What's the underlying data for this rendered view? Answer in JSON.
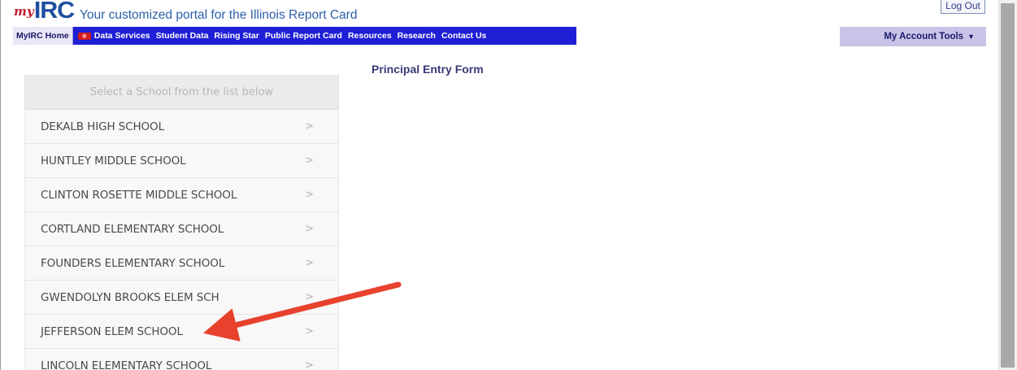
{
  "header": {
    "logo_prefix": "my",
    "logo_main": "IRC",
    "tagline": "Your customized portal for the Illinois Report Card",
    "logout_label": "Log Out"
  },
  "nav": {
    "home_label": "MyIRC Home",
    "items": [
      "Data Services",
      "Student Data",
      "Rising Star",
      "Public Report Card",
      "Resources",
      "Research",
      "Contact Us"
    ],
    "account_tools_label": "My Account Tools"
  },
  "main": {
    "form_title": "Principal Entry Form"
  },
  "school_list": {
    "header": "Select a School from the list below",
    "schools": [
      "DEKALB HIGH SCHOOL",
      "HUNTLEY MIDDLE SCHOOL",
      "CLINTON ROSETTE MIDDLE SCHOOL",
      "CORTLAND ELEMENTARY SCHOOL",
      "FOUNDERS ELEMENTARY SCHOOL",
      "GWENDOLYN BROOKS ELEM SCH",
      "JEFFERSON ELEM SCHOOL",
      "LINCOLN ELEMENTARY SCHOOL"
    ],
    "highlighted": "JEFFERSON ELEM SCHOOL"
  },
  "colors": {
    "nav_background": "#1f1fd6",
    "logo_red": "#c0192b",
    "logo_blue": "#1f4fa0",
    "annotation_arrow": "#e8412e"
  },
  "icons": {
    "row_chevron": "chevron-right-icon",
    "account_caret": "caret-down-icon"
  }
}
